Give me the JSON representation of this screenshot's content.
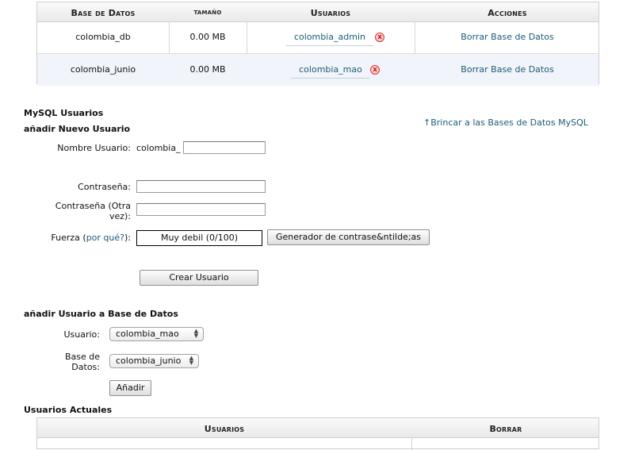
{
  "databases_table": {
    "headers": {
      "db": "Base de Datos",
      "size": "tamaño",
      "users": "Usuarios",
      "actions": "Acciones"
    },
    "rows": [
      {
        "db": "colombia_db",
        "size": "0.00 MB",
        "user": "colombia_admin",
        "action": "Borrar Base de Datos"
      },
      {
        "db": "colombia_junio",
        "size": "0.00 MB",
        "user": "colombia_mao",
        "action": "Borrar Base de Datos"
      }
    ],
    "delete_glyph": "x"
  },
  "mysql_users": {
    "title": "MySQL Usuarios",
    "jump_link": "Brincar a las Bases de Datos MySQL",
    "jump_arrow": "↑",
    "add_user": {
      "title": "añadir Nuevo Usuario",
      "username_label": "Nombre Usuario:",
      "username_prefix": "colombia_",
      "username_value": "",
      "password_label": "Contraseña:",
      "password_again_label_1": "Contraseña (Otra",
      "password_again_label_2": "vez):",
      "strength_label": "Fuerza",
      "strength_paren_open": "(",
      "strength_link": "por qué?",
      "strength_paren_close": "):",
      "strength_value": "Muy debil (0/100)",
      "generator_button": "Generador de contrase&ntilde;as",
      "create_button": "Crear Usuario"
    }
  },
  "add_user_to_db": {
    "title": "añadir Usuario a Base de Datos",
    "user_label": "Usuario:",
    "user_selected": "colombia_mao",
    "db_label_1": "Base de",
    "db_label_2": "Datos:",
    "db_selected": "colombia_junio",
    "add_button": "Añadir"
  },
  "current_users": {
    "title": "Usuarios Actuales",
    "headers": {
      "users": "Usuarios",
      "delete": "Borrar"
    }
  },
  "colors": {
    "link": "#1b5c73",
    "delete_red": "#d33333",
    "row_alt": "#f1f4fa"
  }
}
